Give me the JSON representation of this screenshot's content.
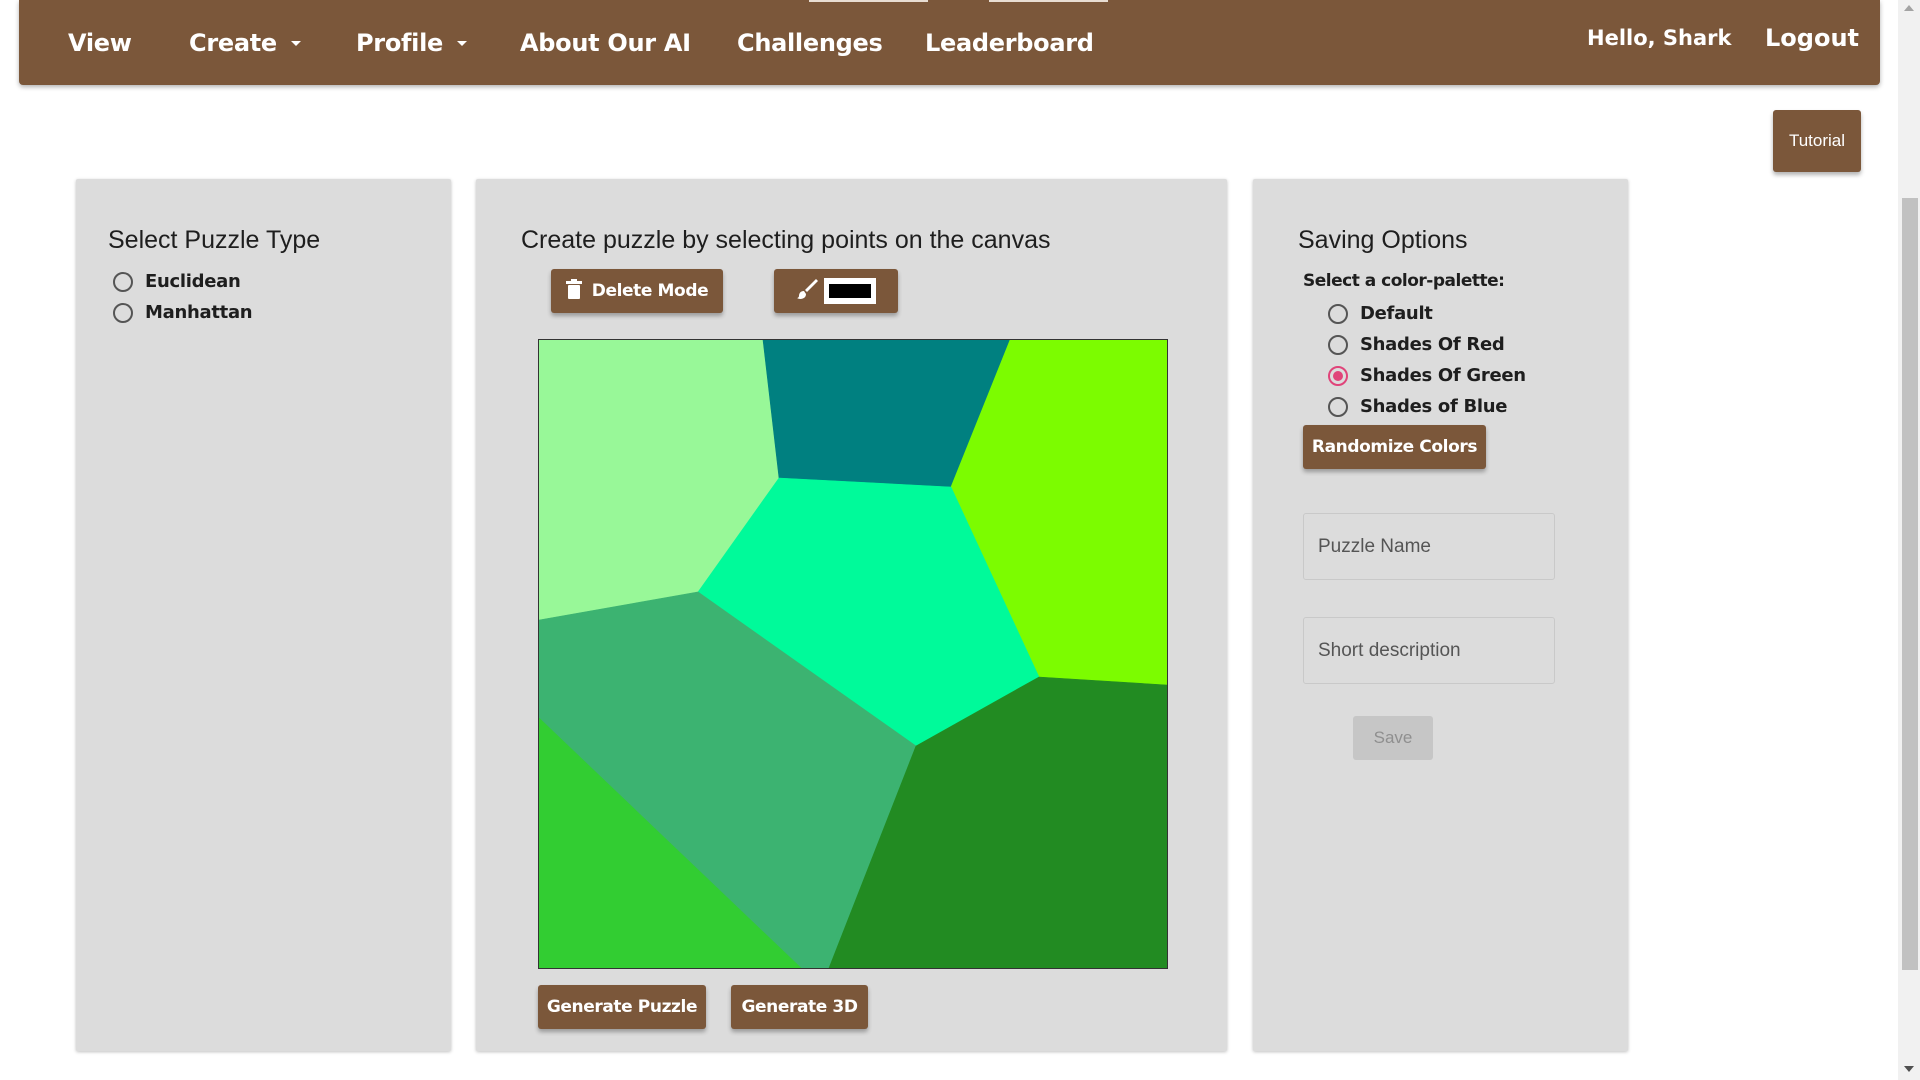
{
  "nav": {
    "items": [
      {
        "label": "View",
        "dropdown": false
      },
      {
        "label": "Create",
        "dropdown": true
      },
      {
        "label": "Profile",
        "dropdown": true
      },
      {
        "label": "About Our AI",
        "dropdown": false
      },
      {
        "label": "Challenges",
        "dropdown": false
      },
      {
        "label": "Leaderboard",
        "dropdown": false
      }
    ],
    "greeting": "Hello, Shark",
    "logout": "Logout"
  },
  "tutorial_label": "Tutorial",
  "puzzle_type": {
    "title": "Select Puzzle Type",
    "options": [
      "Euclidean",
      "Manhattan"
    ],
    "selected": null
  },
  "canvas_panel": {
    "title": "Create puzzle by selecting points on the canvas",
    "delete_mode_label": "Delete Mode",
    "brush_color": "#000000",
    "generate_puzzle_label": "Generate Puzzle",
    "generate_3d_label": "Generate 3D",
    "region_colors": {
      "light_green": "#98f898",
      "teal": "#008080",
      "lawn_green": "#7cfc00",
      "spring_green": "#00fa9a",
      "medium_sea_green": "#3cb371",
      "lime_green": "#32cd32",
      "forest_green": "#228b22"
    }
  },
  "saving": {
    "title": "Saving Options",
    "palette_label": "Select a color-palette:",
    "palettes": [
      "Default",
      "Shades Of Red",
      "Shades Of Green",
      "Shades of Blue"
    ],
    "selected_palette": "Shades Of Green",
    "randomize_label": "Randomize Colors",
    "name_placeholder": "Puzzle Name",
    "description_placeholder": "Short description",
    "save_label": "Save"
  },
  "colors": {
    "brand_brown": "#7b573a",
    "panel_gray": "#dcdcdc",
    "radio_accent": "#e0447a"
  }
}
